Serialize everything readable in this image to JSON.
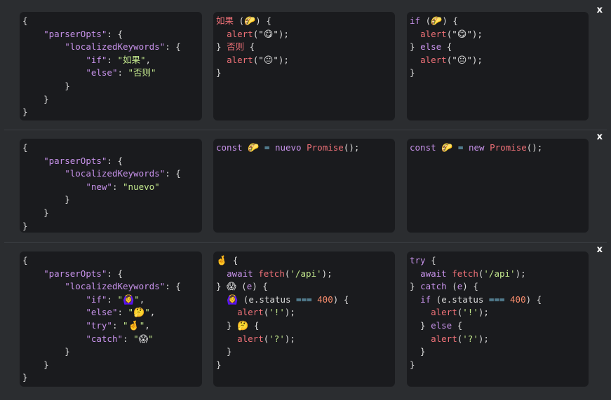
{
  "rows": [
    {
      "close_label": "x",
      "config": [
        [
          [
            "p",
            "{"
          ]
        ],
        [
          [
            "p",
            "    "
          ],
          [
            "k",
            "\"parserOpts\""
          ],
          [
            "p",
            ": {"
          ]
        ],
        [
          [
            "p",
            "        "
          ],
          [
            "k",
            "\"localizedKeywords\""
          ],
          [
            "p",
            ": {"
          ]
        ],
        [
          [
            "p",
            "            "
          ],
          [
            "k",
            "\"if\""
          ],
          [
            "p",
            ": "
          ],
          [
            "s",
            "\"如果\""
          ],
          [
            "p",
            ","
          ]
        ],
        [
          [
            "p",
            "            "
          ],
          [
            "k",
            "\"else\""
          ],
          [
            "p",
            ": "
          ],
          [
            "s",
            "\"否则\""
          ]
        ],
        [
          [
            "p",
            "        }"
          ]
        ],
        [
          [
            "p",
            "    }"
          ]
        ],
        [
          [
            "p",
            "}"
          ]
        ]
      ],
      "source": [
        [
          [
            "r",
            "如果"
          ],
          [
            "p",
            " ("
          ],
          [
            "e",
            "🌮"
          ],
          [
            "p",
            ") {"
          ]
        ],
        [
          [
            "p",
            "  "
          ],
          [
            "f",
            "alert"
          ],
          [
            "p",
            "(\""
          ],
          [
            "e",
            "😋"
          ],
          [
            "p",
            "\");"
          ]
        ],
        [
          [
            "p",
            "} "
          ],
          [
            "r",
            "否则"
          ],
          [
            "p",
            " {"
          ]
        ],
        [
          [
            "p",
            "  "
          ],
          [
            "f",
            "alert"
          ],
          [
            "p",
            "(\""
          ],
          [
            "e",
            "😐"
          ],
          [
            "p",
            "\");"
          ]
        ],
        [
          [
            "p",
            "}"
          ]
        ]
      ],
      "output": [
        [
          [
            "k",
            "if"
          ],
          [
            "p",
            " ("
          ],
          [
            "e",
            "🌮"
          ],
          [
            "p",
            ") {"
          ]
        ],
        [
          [
            "p",
            "  "
          ],
          [
            "f",
            "alert"
          ],
          [
            "p",
            "(\""
          ],
          [
            "e",
            "😋"
          ],
          [
            "p",
            "\");"
          ]
        ],
        [
          [
            "p",
            "} "
          ],
          [
            "k",
            "else"
          ],
          [
            "p",
            " {"
          ]
        ],
        [
          [
            "p",
            "  "
          ],
          [
            "f",
            "alert"
          ],
          [
            "p",
            "(\""
          ],
          [
            "e",
            "😐"
          ],
          [
            "p",
            "\");"
          ]
        ],
        [
          [
            "p",
            "}"
          ]
        ]
      ]
    },
    {
      "close_label": "x",
      "config": [
        [
          [
            "p",
            "{"
          ]
        ],
        [
          [
            "p",
            "    "
          ],
          [
            "k",
            "\"parserOpts\""
          ],
          [
            "p",
            ": {"
          ]
        ],
        [
          [
            "p",
            "        "
          ],
          [
            "k",
            "\"localizedKeywords\""
          ],
          [
            "p",
            ": {"
          ]
        ],
        [
          [
            "p",
            "            "
          ],
          [
            "k",
            "\"new\""
          ],
          [
            "p",
            ": "
          ],
          [
            "s",
            "\"nuevo\""
          ]
        ],
        [
          [
            "p",
            "        }"
          ]
        ],
        [
          [
            "p",
            "    }"
          ]
        ],
        [
          [
            "p",
            "}"
          ]
        ]
      ],
      "source": [
        [
          [
            "k",
            "const"
          ],
          [
            "p",
            " "
          ],
          [
            "e",
            "🌮"
          ],
          [
            "p",
            " "
          ],
          [
            "o",
            "="
          ],
          [
            "p",
            " "
          ],
          [
            "k",
            "nuevo"
          ],
          [
            "p",
            " "
          ],
          [
            "f",
            "Promise"
          ],
          [
            "p",
            "();"
          ]
        ]
      ],
      "output": [
        [
          [
            "k",
            "const"
          ],
          [
            "p",
            " "
          ],
          [
            "e",
            "🌮"
          ],
          [
            "p",
            " "
          ],
          [
            "o",
            "="
          ],
          [
            "p",
            " "
          ],
          [
            "k",
            "new"
          ],
          [
            "p",
            " "
          ],
          [
            "f",
            "Promise"
          ],
          [
            "p",
            "();"
          ]
        ]
      ]
    },
    {
      "close_label": "x",
      "config": [
        [
          [
            "p",
            "{"
          ]
        ],
        [
          [
            "p",
            "    "
          ],
          [
            "k",
            "\"parserOpts\""
          ],
          [
            "p",
            ": {"
          ]
        ],
        [
          [
            "p",
            "        "
          ],
          [
            "k",
            "\"localizedKeywords\""
          ],
          [
            "p",
            ": {"
          ]
        ],
        [
          [
            "p",
            "            "
          ],
          [
            "k",
            "\"if\""
          ],
          [
            "p",
            ": "
          ],
          [
            "s",
            "\""
          ],
          [
            "e",
            "🙆‍♀️"
          ],
          [
            "s",
            "\""
          ],
          [
            "p",
            ","
          ]
        ],
        [
          [
            "p",
            "            "
          ],
          [
            "k",
            "\"else\""
          ],
          [
            "p",
            ": "
          ],
          [
            "s",
            "\""
          ],
          [
            "e",
            "🤔"
          ],
          [
            "s",
            "\""
          ],
          [
            "p",
            ","
          ]
        ],
        [
          [
            "p",
            "            "
          ],
          [
            "k",
            "\"try\""
          ],
          [
            "p",
            ": "
          ],
          [
            "s",
            "\""
          ],
          [
            "e",
            "🤞"
          ],
          [
            "s",
            "\""
          ],
          [
            "p",
            ","
          ]
        ],
        [
          [
            "p",
            "            "
          ],
          [
            "k",
            "\"catch\""
          ],
          [
            "p",
            ": "
          ],
          [
            "s",
            "\""
          ],
          [
            "e",
            "😱"
          ],
          [
            "s",
            "\""
          ]
        ],
        [
          [
            "p",
            "        }"
          ]
        ],
        [
          [
            "p",
            "    }"
          ]
        ],
        [
          [
            "p",
            "}"
          ]
        ]
      ],
      "source": [
        [
          [
            "e",
            "🤞"
          ],
          [
            "p",
            " {"
          ]
        ],
        [
          [
            "p",
            "  "
          ],
          [
            "k",
            "await"
          ],
          [
            "p",
            " "
          ],
          [
            "f",
            "fetch"
          ],
          [
            "p",
            "("
          ],
          [
            "s",
            "'/api'"
          ],
          [
            "p",
            ");"
          ]
        ],
        [
          [
            "p",
            "} "
          ],
          [
            "e",
            "😱"
          ],
          [
            "p",
            " ("
          ],
          [
            "k",
            "e"
          ],
          [
            "p",
            ") {"
          ]
        ],
        [
          [
            "p",
            "  "
          ],
          [
            "e",
            "🙆‍♀️"
          ],
          [
            "p",
            " ("
          ],
          [
            "p",
            "e.status "
          ],
          [
            "o",
            "==="
          ],
          [
            "p",
            " "
          ],
          [
            "n",
            "400"
          ],
          [
            "p",
            ") {"
          ]
        ],
        [
          [
            "p",
            "    "
          ],
          [
            "f",
            "alert"
          ],
          [
            "p",
            "("
          ],
          [
            "s",
            "'!'"
          ],
          [
            "p",
            ");"
          ]
        ],
        [
          [
            "p",
            "  } "
          ],
          [
            "e",
            "🤔"
          ],
          [
            "p",
            " {"
          ]
        ],
        [
          [
            "p",
            "    "
          ],
          [
            "f",
            "alert"
          ],
          [
            "p",
            "("
          ],
          [
            "s",
            "'?'"
          ],
          [
            "p",
            ");"
          ]
        ],
        [
          [
            "p",
            "  }"
          ]
        ],
        [
          [
            "p",
            "}"
          ]
        ]
      ],
      "output": [
        [
          [
            "k",
            "try"
          ],
          [
            "p",
            " {"
          ]
        ],
        [
          [
            "p",
            "  "
          ],
          [
            "k",
            "await"
          ],
          [
            "p",
            " "
          ],
          [
            "f",
            "fetch"
          ],
          [
            "p",
            "("
          ],
          [
            "s",
            "'/api'"
          ],
          [
            "p",
            ");"
          ]
        ],
        [
          [
            "p",
            "} "
          ],
          [
            "k",
            "catch"
          ],
          [
            "p",
            " ("
          ],
          [
            "k",
            "e"
          ],
          [
            "p",
            ") {"
          ]
        ],
        [
          [
            "p",
            "  "
          ],
          [
            "k",
            "if"
          ],
          [
            "p",
            " ("
          ],
          [
            "p",
            "e.status "
          ],
          [
            "o",
            "==="
          ],
          [
            "p",
            " "
          ],
          [
            "n",
            "400"
          ],
          [
            "p",
            ") {"
          ]
        ],
        [
          [
            "p",
            "    "
          ],
          [
            "f",
            "alert"
          ],
          [
            "p",
            "("
          ],
          [
            "s",
            "'!'"
          ],
          [
            "p",
            ");"
          ]
        ],
        [
          [
            "p",
            "  } "
          ],
          [
            "k",
            "else"
          ],
          [
            "p",
            " {"
          ]
        ],
        [
          [
            "p",
            "    "
          ],
          [
            "f",
            "alert"
          ],
          [
            "p",
            "("
          ],
          [
            "s",
            "'?'"
          ],
          [
            "p",
            ");"
          ]
        ],
        [
          [
            "p",
            "  }"
          ]
        ],
        [
          [
            "p",
            "}"
          ]
        ]
      ]
    }
  ]
}
